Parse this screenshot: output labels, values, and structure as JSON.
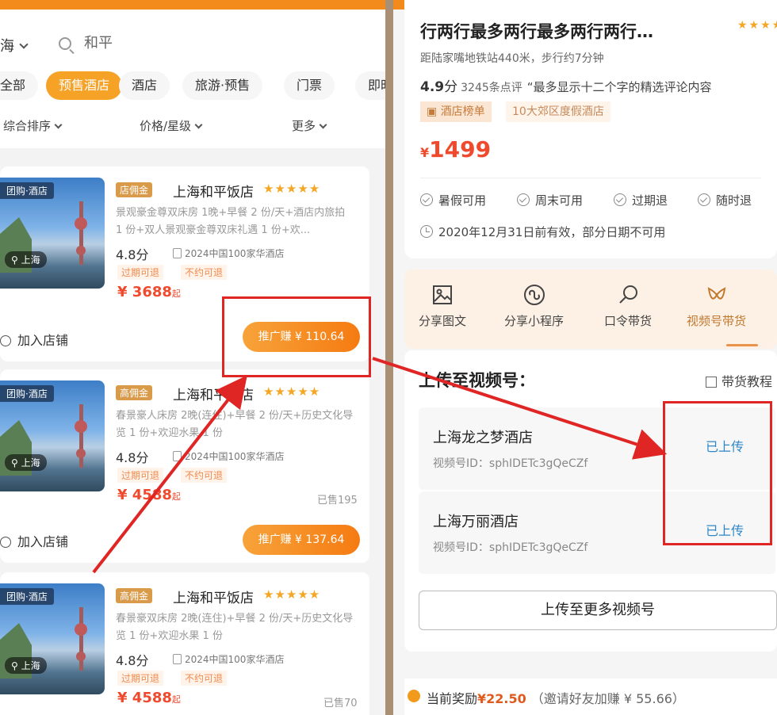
{
  "left": {
    "city": "海",
    "search_value": "和平",
    "categories": [
      "全部",
      "预售酒店",
      "酒店",
      "旅游·预售",
      "门票",
      "即时"
    ],
    "sorts": [
      "综合排序",
      "价格/星级",
      "更多"
    ],
    "cards": [
      {
        "tag": "团购·酒店",
        "city_tag": "上海",
        "badge": "店佣金",
        "name": "上海和平饭店",
        "stars": "★★★★★",
        "desc": "景观豪金尊双床房 1晚+早餐 2 份/天+酒店内旅拍 1 份+双人景观豪金尊双床礼遇 1 份+欢...",
        "score": "4.8分",
        "award": "2024中国100家华酒店",
        "tags": [
          "过期可退",
          "不约可退"
        ],
        "price": "¥ 3688",
        "price_suffix": "起",
        "sold": "",
        "add_store": "加入店铺",
        "promo": "推广赚 ¥ 110.64"
      },
      {
        "tag": "团购·酒店",
        "city_tag": "上海",
        "badge": "高佣金",
        "name": "上海和平饭店",
        "stars": "★★★★★",
        "desc": "春景豪人床房 2晚(连住)+早餐 2 份/天+历史文化导览 1 份+欢迎水果 1 份",
        "score": "4.8分",
        "award": "2024中国100家华酒店",
        "tags": [
          "过期可退",
          "不约可退"
        ],
        "price": "¥ 4588",
        "price_suffix": "起",
        "sold": "已售195",
        "add_store": "加入店铺",
        "promo": "推广赚 ¥ 137.64"
      },
      {
        "tag": "团购·酒店",
        "city_tag": "上海",
        "badge": "高佣金",
        "name": "上海和平饭店",
        "stars": "★★★★★",
        "desc": "春景豪双床房 2晚(连住)+早餐 2 份/天+历史文化导览 1 份+欢迎水果 1 份",
        "score": "4.8分",
        "award": "2024中国100家华酒店",
        "tags": [
          "过期可退",
          "不约可退"
        ],
        "price": "¥ 4588",
        "price_suffix": "起",
        "sold": "已售70"
      }
    ]
  },
  "right": {
    "title": "行两行最多两行最多两行两行…",
    "stars": "★★★★",
    "distance": "距陆家嘴地铁站440米，步行约7分钟",
    "score": "4.9",
    "score_unit": "分",
    "review_count": "3245条点评",
    "review_quote": "“最多显示十二个字的精选评论内容",
    "rank": "酒店榜单",
    "rank_sub": "10大郊区度假酒店",
    "price_symbol": "¥",
    "price": "1499",
    "features": [
      "暑假可用",
      "周末可用",
      "过期退",
      "随时退"
    ],
    "validity": "2020年12月31日前有效，部分日期不可用",
    "share": [
      "分享图文",
      "分享小程序",
      "口令带货",
      "视频号带货"
    ],
    "upload_title": "上传至视频号：",
    "tutorial": "带货教程",
    "accounts": [
      {
        "name": "上海龙之梦酒店",
        "id": "视频号ID：sphIDETc3gQeCZf",
        "status": "已上传"
      },
      {
        "name": "上海万丽酒店",
        "id": "视频号ID：sphIDETc3gQeCZf",
        "status": "已上传"
      }
    ],
    "upload_more": "上传至更多视频号",
    "reward_label": "当前奖励",
    "reward_amount": "¥22.50",
    "invite": "（邀请好友加赚 ¥ 55.66）"
  },
  "colors": {
    "accent": "#f28b1c",
    "price": "#f04a2e",
    "annotation": "#e02525",
    "status": "#2f87c9"
  }
}
